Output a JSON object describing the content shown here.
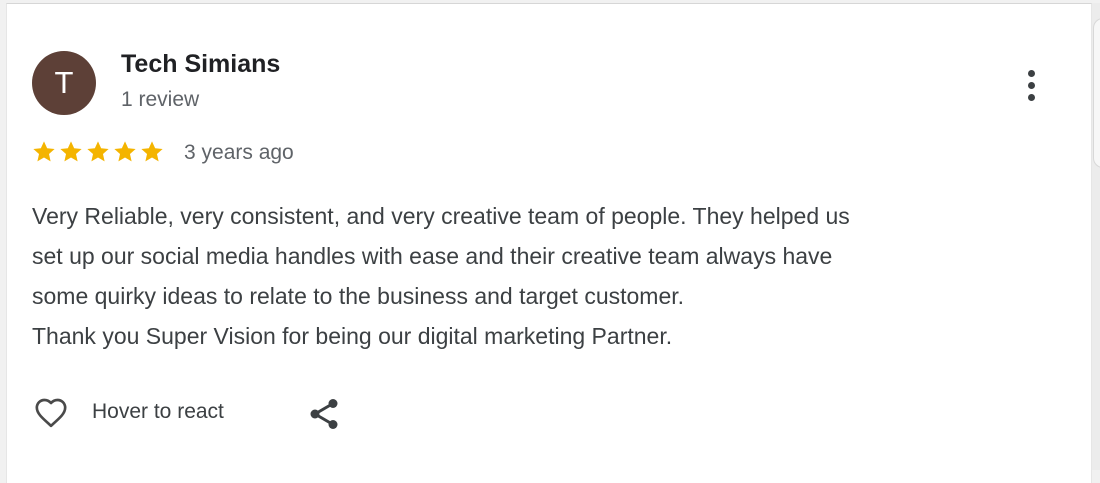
{
  "reviewer": {
    "initial": "T",
    "name": "Tech Simians",
    "review_count": "1 review",
    "avatar_color": "#5d4037"
  },
  "review": {
    "rating": 5,
    "max_rating": 5,
    "star_color": "#f4b400",
    "time": "3 years ago",
    "paragraphs": [
      "Very Reliable, very consistent, and very creative team of people. They helped us",
      "set up our social media handles with ease and their creative team always have",
      "some quirky ideas to relate to the business and target customer.",
      "Thank you Super Vision for being our digital marketing Partner."
    ]
  },
  "actions": {
    "react_label": "Hover to react",
    "react_icon": "heart-outline-icon",
    "share_icon": "share-icon",
    "more_icon": "more-vert-icon"
  }
}
